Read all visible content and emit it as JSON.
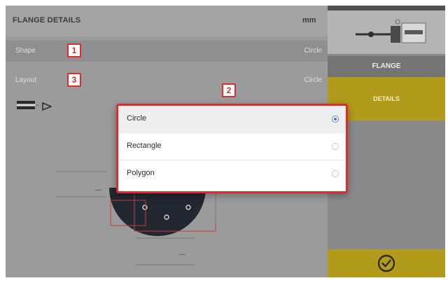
{
  "header": {
    "title": "FLANGE DETAILS",
    "units": "mm"
  },
  "rows": {
    "shape": {
      "label": "Shape",
      "value": "Circle"
    },
    "layout": {
      "label": "Layout",
      "value": "Circle"
    }
  },
  "badges": {
    "shape": "1",
    "dropdown": "2",
    "layout": "3"
  },
  "dimensions": {
    "left": "---",
    "bottom": "---"
  },
  "sidebar": {
    "flange_tab": "FLANGE",
    "details_tab": "DETAILS"
  },
  "dropdown": {
    "options": [
      {
        "label": "Circle",
        "selected": true
      },
      {
        "label": "Rectangle",
        "selected": false
      },
      {
        "label": "Polygon",
        "selected": false
      }
    ]
  },
  "icons": {
    "layout_bar": "flange-bar-icon",
    "layout_arrow": "arrow-icon",
    "confirm": "checkmark-circle-icon"
  },
  "colors": {
    "accent_yellow": "#b29a1b",
    "annotation_red": "#e12c2c",
    "radio_blue": "#4a6fd3"
  }
}
